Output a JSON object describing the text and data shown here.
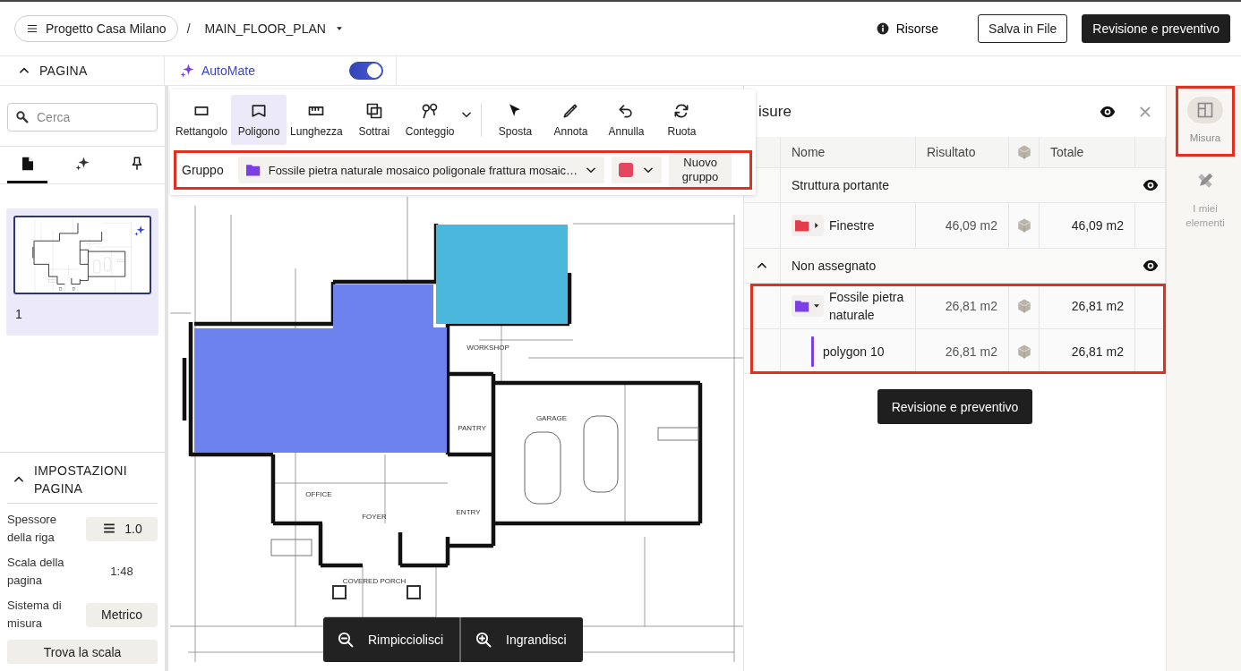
{
  "header": {
    "project": "Progetto Casa Milano",
    "separator": "/",
    "document": "MAIN_FLOOR_PLAN",
    "resources": "Risorse",
    "buttons": [
      {
        "label": "Salva in File",
        "kind": "outline"
      },
      {
        "label": "Revisione e preventivo",
        "kind": "primary"
      }
    ]
  },
  "page_bar": {
    "title": "PAGINA",
    "expanded": true
  },
  "automate": {
    "label": "AutoMate",
    "on": true
  },
  "sidebar": {
    "search": {
      "placeholder": "Cerca"
    },
    "tabs": [
      {
        "kind": "pages",
        "selected": true
      },
      {
        "kind": "ai",
        "selected": false
      },
      {
        "kind": "pin",
        "selected": false
      }
    ],
    "pages": [
      {
        "label": "1",
        "selected": true
      }
    ],
    "settings": {
      "title": "IMPOSTAZIONI PAGINA",
      "expanded": true,
      "rows": [
        {
          "label": "Spessore della riga",
          "value": "1.0",
          "kind": "line"
        },
        {
          "label": "Scala della pagina",
          "value": "1:48",
          "kind": "text"
        },
        {
          "label": "Sistema di misura",
          "value": "Metrico",
          "kind": "select"
        }
      ],
      "button": "Trova la scala"
    }
  },
  "tools": [
    {
      "label": "Rettangolo",
      "kind": "rect",
      "selected": false
    },
    {
      "label": "Poligono",
      "kind": "polygon",
      "selected": true
    },
    {
      "label": "Lunghezza",
      "kind": "length",
      "selected": false
    },
    {
      "label": "Sottrai",
      "kind": "subtract",
      "selected": false
    },
    {
      "label": "Conteggio",
      "kind": "count",
      "selected": false
    }
  ],
  "actions": [
    {
      "label": "Sposta",
      "kind": "move"
    },
    {
      "label": "Annota",
      "kind": "annotate"
    },
    {
      "label": "Annulla",
      "kind": "undo"
    },
    {
      "label": "Ruota",
      "kind": "rotate"
    }
  ],
  "group_bar": {
    "label": "Gruppo",
    "group": "Fossile pietra naturale mosaico poligonale frattura mosaic…",
    "color": "#e5455e",
    "new_group": "Nuovo gruppo",
    "highlighted": true
  },
  "plan": {
    "rooms": [
      "WORKSHOP",
      "GARAGE",
      "PANTRY",
      "OFFICE",
      "ENTRY",
      "FOYER",
      "COVERED PORCH"
    ],
    "areas": [
      {
        "kind": "polygon",
        "color": "#6d82ec"
      },
      {
        "kind": "rect",
        "color": "#4ab8dc"
      }
    ]
  },
  "zoom": [
    {
      "kind": "out",
      "label": "Rimpicciolisci"
    },
    {
      "kind": "in",
      "label": "Ingrandisci"
    }
  ],
  "measurements": {
    "title": "isure",
    "columns": [
      {
        "kind": "text",
        "label": "Nome"
      },
      {
        "kind": "text",
        "label": "Risultato"
      },
      {
        "kind": "cube"
      },
      {
        "kind": "text",
        "label": "Totale"
      }
    ],
    "groups": [
      {
        "name": "Struttura portante",
        "collapsible": false,
        "visible": true,
        "items": [
          {
            "name": "Finestre",
            "color": "#e23d4b",
            "expanded": false,
            "result": "46,09 m2",
            "total": "46,09 m2",
            "highlighted": false
          }
        ]
      },
      {
        "name": "Non assegnato",
        "collapsible": true,
        "visible": true,
        "items": [
          {
            "name": "Fossile pietra naturale",
            "color": "#7b3fe4",
            "expanded": true,
            "result": "26,81 m2",
            "total": "26,81 m2",
            "highlighted": true,
            "children": [
              {
                "name": "polygon 10",
                "color": "#7b3fe4",
                "result": "26,81 m2",
                "total": "26,81 m2"
              }
            ]
          }
        ]
      }
    ],
    "button": "Revisione e preventivo"
  },
  "rail": [
    {
      "label": "Misura",
      "kind": "measure",
      "selected": true,
      "highlighted": true
    },
    {
      "label": "I miei elementi",
      "kind": "elements",
      "selected": false,
      "highlighted": false
    }
  ]
}
